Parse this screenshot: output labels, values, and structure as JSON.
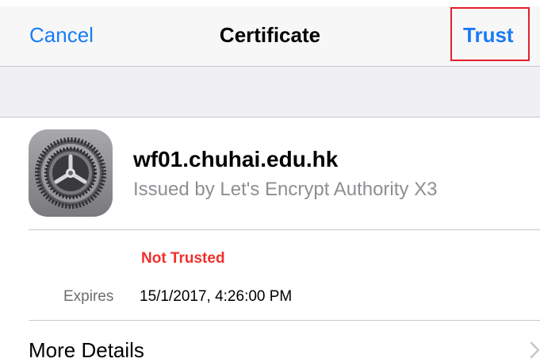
{
  "navbar": {
    "cancel_label": "Cancel",
    "title": "Certificate",
    "trust_label": "Trust"
  },
  "certificate": {
    "icon": "settings-gear-icon",
    "name": "wf01.chuhai.edu.hk",
    "issuer": "Issued by Let's Encrypt Authority X3",
    "status": "Not Trusted",
    "expires_label": "Expires",
    "expires_value": "15/1/2017, 4:26:00 PM"
  },
  "more_details": {
    "label": "More Details",
    "icon": "chevron-right-icon"
  },
  "colors": {
    "accent": "#1a7cf5",
    "danger": "#f0302c",
    "highlight_box": "#e2202d",
    "secondary_text": "#8e8e93"
  }
}
